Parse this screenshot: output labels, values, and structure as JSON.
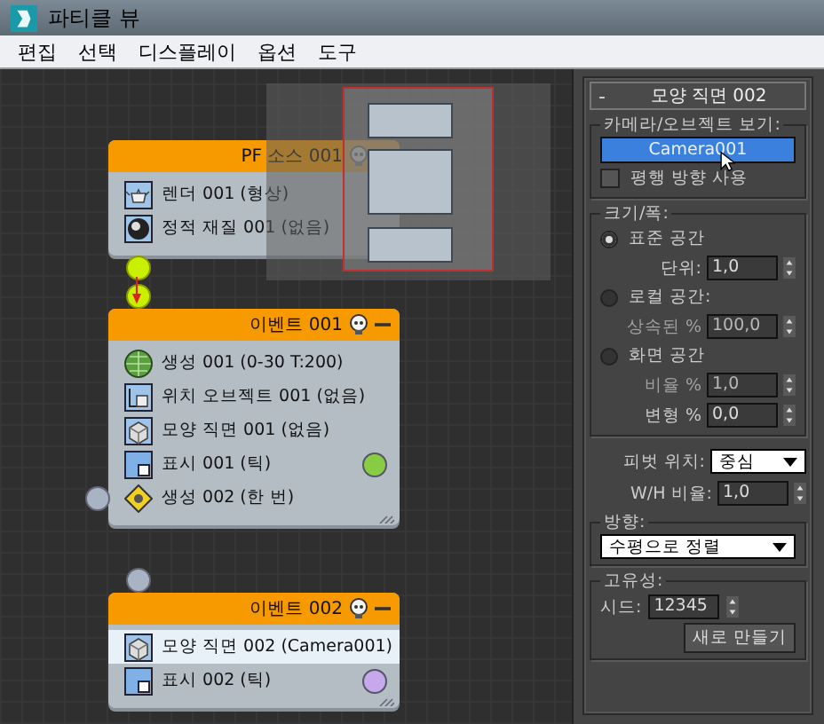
{
  "window": {
    "title": "파티클 뷰"
  },
  "menu": [
    "편집",
    "선택",
    "디스플레이",
    "옵션",
    "도구"
  ],
  "nodes": [
    {
      "title": "PF 소스 001",
      "output_linked": true,
      "items": [
        {
          "kind": "render",
          "label": "렌더 001 (형상)",
          "selected": false
        },
        {
          "kind": "material",
          "label": "정적 재질 001 (없음)",
          "selected": false
        }
      ]
    },
    {
      "title": "이벤트 001",
      "input_linked": true,
      "items": [
        {
          "kind": "birth",
          "label": "생성 001 (0-30 T:200)",
          "selected": false
        },
        {
          "kind": "position",
          "label": "위치 오브젝트 001 (없음)",
          "selected": false
        },
        {
          "kind": "shape",
          "label": "모양 직면 001 (없음)",
          "selected": false
        },
        {
          "kind": "display",
          "label": "표시 001 (틱)",
          "selected": false,
          "color": "#88cc44"
        },
        {
          "kind": "spawn",
          "label": "생성 002 (한 번)",
          "selected": false,
          "side_output": true
        }
      ]
    },
    {
      "title": "이벤트 002",
      "input_linked": false,
      "items": [
        {
          "kind": "shape",
          "label": "모양 직면 002 (Camera001)",
          "selected": true
        },
        {
          "kind": "display",
          "label": "표시 002 (틱)",
          "selected": false,
          "color": "#c8a8ec"
        }
      ]
    }
  ],
  "panel": {
    "collapse": "-",
    "title": "모양 직면 002",
    "camera_group": {
      "label": "카메라/오브젝트 보기:",
      "button": "Camera001",
      "parallel": {
        "label": "평행 방향 사용",
        "checked": false
      }
    },
    "size_group": {
      "label": "크기/폭:",
      "options": [
        {
          "label": "표준 공간",
          "selected": true,
          "fields": [
            {
              "label": "단위:",
              "value": "1,0",
              "disabled": false
            }
          ]
        },
        {
          "label": "로컬 공간:",
          "selected": false,
          "fields": [
            {
              "label": "상속된 %",
              "value": "100,0",
              "disabled": true
            }
          ]
        },
        {
          "label": "화면 공간",
          "selected": false,
          "fields": [
            {
              "label": "비율 %",
              "value": "1,0",
              "disabled": true
            },
            {
              "label": "변형 %",
              "value": "0,0",
              "disabled": false
            }
          ]
        }
      ]
    },
    "pivot": {
      "label": "피벗 위치:",
      "value": "중심"
    },
    "wh": {
      "label": "W/H 비율:",
      "value": "1,0"
    },
    "orientation": {
      "label": "방향:",
      "value": "수평으로 정렬"
    },
    "uniqueness": {
      "label": "고유성:",
      "seed_label": "시드:",
      "seed": "12345",
      "button": "새로 만들기"
    }
  }
}
